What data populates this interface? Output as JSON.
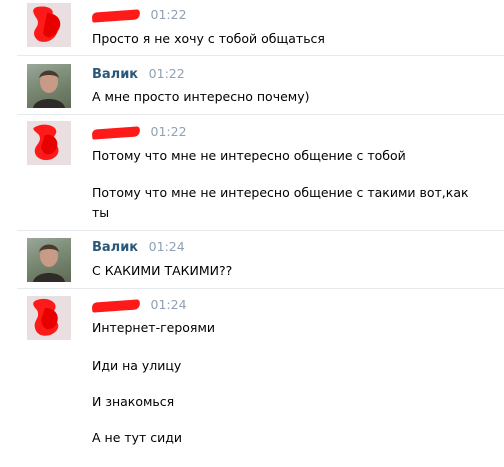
{
  "messages": [
    {
      "author": "",
      "author_redacted": true,
      "time": "01:22",
      "lines": [
        "Просто я не хочу с тобой общаться"
      ],
      "avatar": "redacted-avatar"
    },
    {
      "author": "Валик",
      "author_redacted": false,
      "time": "01:22",
      "lines": [
        "А мне просто интересно почему)"
      ],
      "avatar": "user-photo-avatar"
    },
    {
      "author": "",
      "author_redacted": true,
      "time": "01:22",
      "lines": [
        "Потому что мне не интересно общение с тобой",
        "Потому что мне не интересно общение с такими вот,как ты"
      ],
      "avatar": "redacted-avatar"
    },
    {
      "author": "Валик",
      "author_redacted": false,
      "time": "01:24",
      "lines": [
        "С КАКИМИ ТАКИМИ??"
      ],
      "avatar": "user-photo-avatar"
    },
    {
      "author": "",
      "author_redacted": true,
      "time": "01:24",
      "lines": [
        "Интернет-героями",
        "Иди на улицу",
        "И знакомься",
        "А не тут сиди"
      ],
      "avatar": "redacted-avatar"
    }
  ],
  "colors": {
    "author": "#2b587a",
    "time": "#8fa1b3",
    "redaction": "#ff1a1a",
    "divider": "#e7eaed"
  }
}
